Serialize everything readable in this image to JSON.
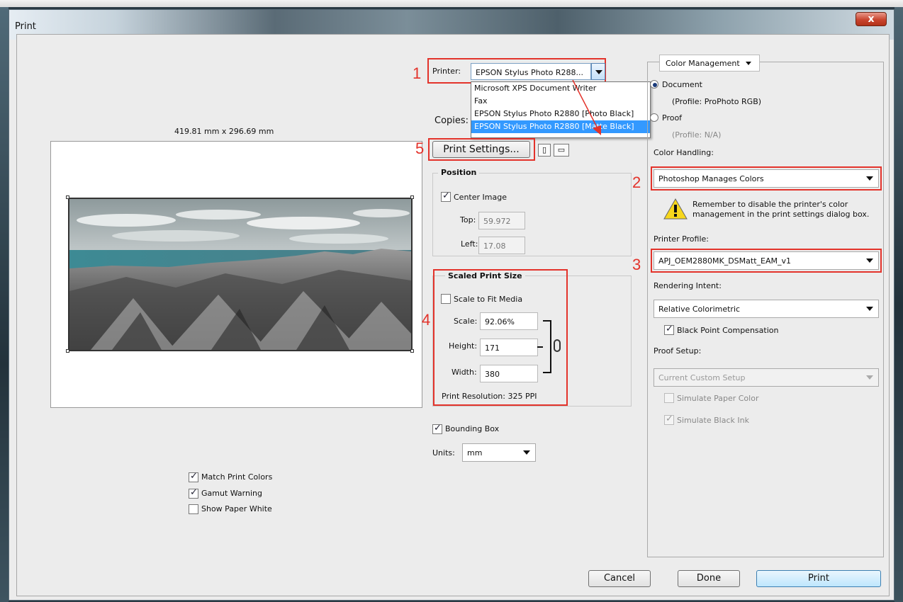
{
  "window": {
    "title": "Print",
    "close_label": "x"
  },
  "preview": {
    "dimensions": "419.81 mm x 296.69 mm",
    "match_print_colors": {
      "label": "Match Print Colors",
      "checked": true
    },
    "gamut_warning": {
      "label": "Gamut Warning",
      "checked": true
    },
    "show_paper_white": {
      "label": "Show Paper White",
      "checked": false
    }
  },
  "printer": {
    "label": "Printer:",
    "selected": "EPSON Stylus Photo R288...",
    "options": [
      "Microsoft XPS Document Writer",
      "Fax",
      "EPSON Stylus Photo R2880 [Photo Black]",
      "EPSON Stylus Photo R2880 [Matte Black]"
    ],
    "highlighted_index": 3,
    "copies_label": "Copies:",
    "print_settings_label": "Print Settings..."
  },
  "position": {
    "title": "Position",
    "center_image": {
      "label": "Center Image",
      "checked": true
    },
    "top_label": "Top:",
    "top_value": "59.972",
    "left_label": "Left:",
    "left_value": "17.08"
  },
  "scaled": {
    "title": "Scaled Print Size",
    "scale_to_fit": {
      "label": "Scale to Fit Media",
      "checked": false
    },
    "scale_label": "Scale:",
    "scale_value": "92.06%",
    "height_label": "Height:",
    "height_value": "171",
    "width_label": "Width:",
    "width_value": "380",
    "resolution": "Print Resolution: 325 PPI"
  },
  "bounding_box": {
    "label": "Bounding Box",
    "checked": true
  },
  "units": {
    "label": "Units:",
    "value": "mm"
  },
  "color_mgmt": {
    "menu_label": "Color Management",
    "document_label": "Document",
    "document_profile": "(Profile: ProPhoto RGB)",
    "proof_label": "Proof",
    "proof_profile": "(Profile: N/A)",
    "handling_label": "Color Handling:",
    "handling_value": "Photoshop Manages Colors",
    "warning_text": "Remember to disable the printer's color management in the print settings dialog box.",
    "printer_profile_label": "Printer Profile:",
    "printer_profile_value": "APJ_OEM2880MK_DSMatt_EAM_v1",
    "rendering_label": "Rendering Intent:",
    "rendering_value": "Relative Colorimetric",
    "bpc": {
      "label": "Black Point Compensation",
      "checked": true
    },
    "proof_setup_label": "Proof Setup:",
    "proof_setup_value": "Current Custom Setup",
    "simulate_paper": {
      "label": "Simulate Paper Color",
      "checked": false
    },
    "simulate_ink": {
      "label": "Simulate Black Ink",
      "checked": true
    }
  },
  "annotations": [
    "1",
    "2",
    "3",
    "4",
    "5"
  ],
  "buttons": {
    "cancel": "Cancel",
    "done": "Done",
    "print": "Print"
  }
}
